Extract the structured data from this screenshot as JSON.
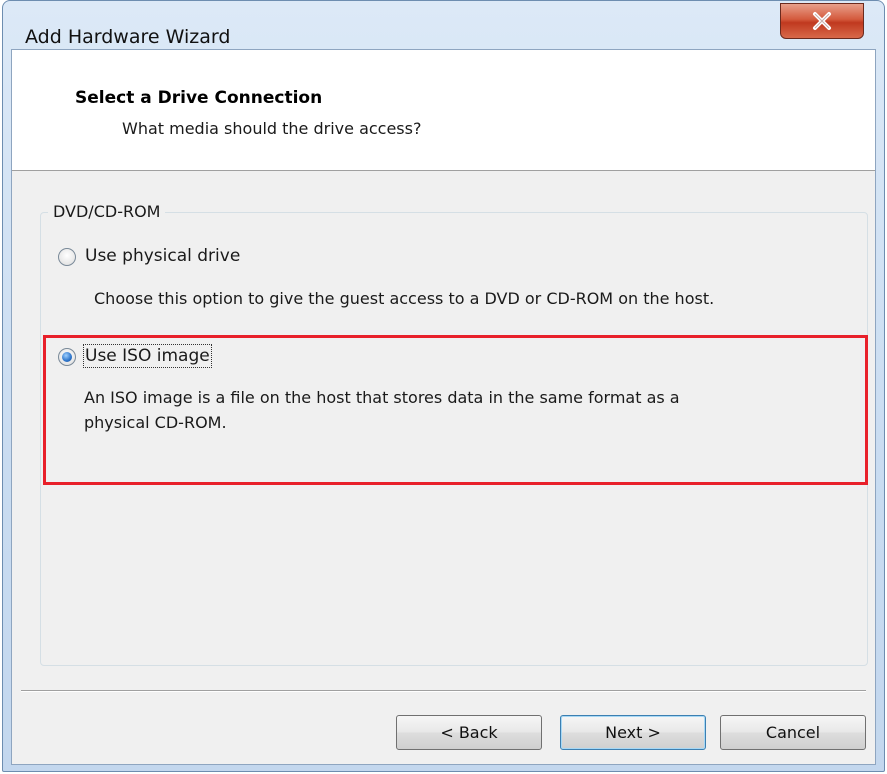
{
  "window": {
    "title": "Add Hardware Wizard"
  },
  "header": {
    "title": "Select a Drive Connection",
    "subtitle": "What media should the drive access?"
  },
  "group": {
    "label": "DVD/CD-ROM",
    "options": [
      {
        "label": "Use physical drive",
        "description": "Choose this option to give the guest access to a DVD or CD-ROM on the host.",
        "selected": false
      },
      {
        "label": "Use ISO image",
        "description_line1": "An ISO image is a file on the host that stores data in the same format as a",
        "description_line2": "physical CD-ROM.",
        "selected": true
      }
    ]
  },
  "buttons": {
    "back": "< Back",
    "next": "Next >",
    "cancel": "Cancel"
  },
  "icons": {
    "close": "close-icon"
  },
  "colors": {
    "highlight": "#e8202a",
    "close_button": "#c0391f"
  }
}
